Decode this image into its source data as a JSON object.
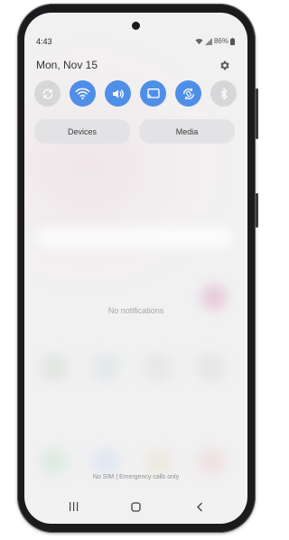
{
  "status_bar": {
    "time": "4:43",
    "battery": "86%",
    "icons": [
      "wifi-icon",
      "signal-icon",
      "battery-icon"
    ]
  },
  "header": {
    "date": "Mon, Nov 15",
    "settings_icon": "gear-icon"
  },
  "quick_settings": [
    {
      "name": "refresh-sync-icon",
      "state": "off"
    },
    {
      "name": "wifi-icon",
      "state": "on"
    },
    {
      "name": "sound-icon",
      "state": "on"
    },
    {
      "name": "cast-icon",
      "state": "on"
    },
    {
      "name": "auto-rotate-icon",
      "state": "on"
    },
    {
      "name": "bluetooth-icon",
      "state": "off"
    }
  ],
  "panels": {
    "devices_label": "Devices",
    "media_label": "Media"
  },
  "notifications": {
    "empty_text": "No notifications"
  },
  "lockscreen": {
    "footer_text": "No SIM | Emergency calls only"
  },
  "nav_bar": {
    "buttons": [
      "recents-icon",
      "home-icon",
      "back-icon"
    ]
  },
  "colors": {
    "accent": "#4f8fe8",
    "tile_off": "#d7d7da",
    "pill_bg": "#e3e3e6",
    "phone_frame": "#1b1b1d"
  }
}
